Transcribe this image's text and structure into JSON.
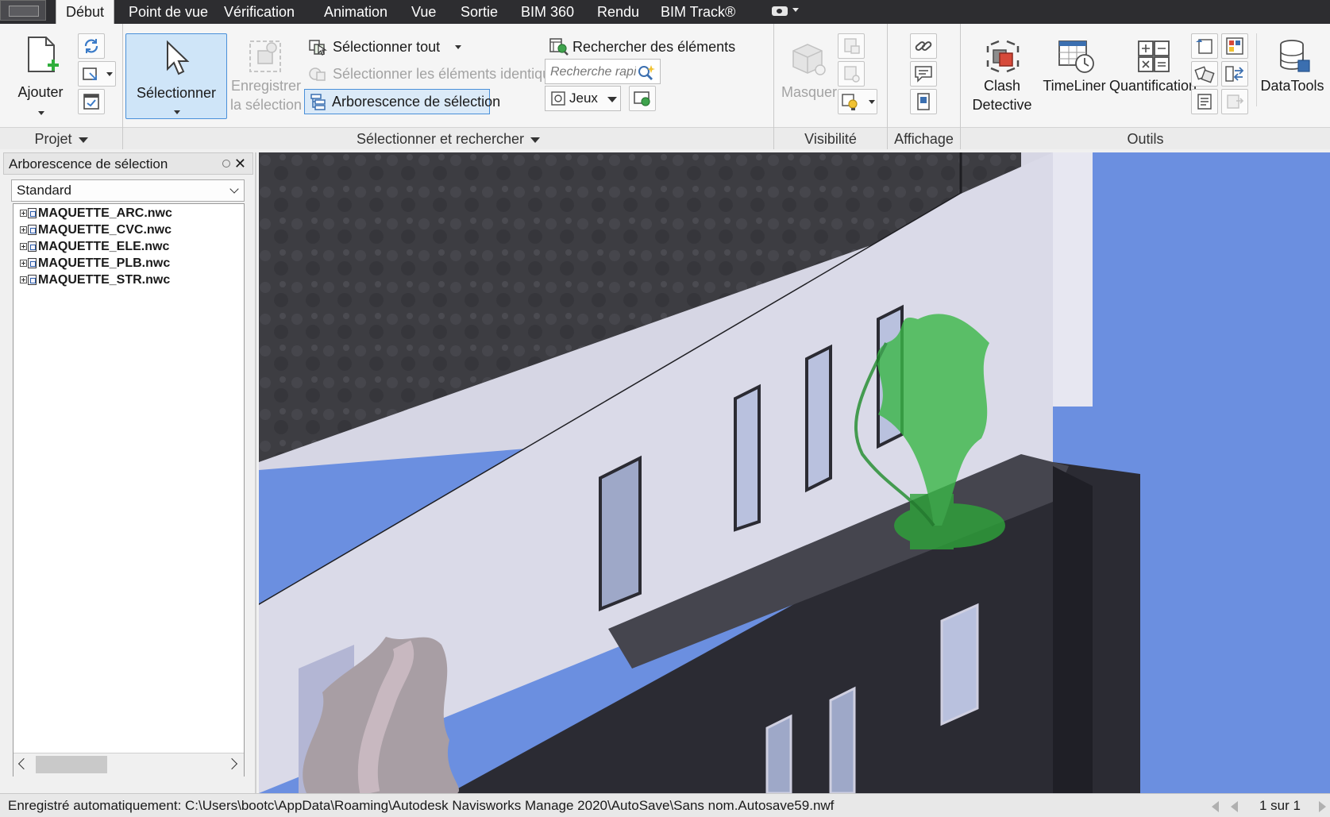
{
  "tabs": [
    {
      "label": "Début",
      "active": true
    },
    {
      "label": "Point de vue",
      "active": false
    },
    {
      "label": "Vérification",
      "active": false
    },
    {
      "label": "Animation",
      "active": false
    },
    {
      "label": "Vue",
      "active": false
    },
    {
      "label": "Sortie",
      "active": false
    },
    {
      "label": "BIM 360",
      "active": false
    },
    {
      "label": "Rendu",
      "active": false
    },
    {
      "label": "BIM Track®",
      "active": false
    }
  ],
  "ribbon": {
    "projet": {
      "title": "Projet",
      "add_label": "Ajouter"
    },
    "selection": {
      "title": "Sélectionner et rechercher",
      "select_label": "Sélectionner",
      "save_selection_line1": "Enregistrer",
      "save_selection_line2": "la sélection",
      "select_all": "Sélectionner tout",
      "select_same": "Sélectionner les éléments identiques",
      "selection_tree": "Arborescence de sélection",
      "find_items": "Rechercher des éléments",
      "quick_find_placeholder": "Recherche rapi",
      "sets_label": "Jeux"
    },
    "visibilite": {
      "title": "Visibilité",
      "hide_label": "Masquer"
    },
    "affichage": {
      "title": "Affichage"
    },
    "outils": {
      "title": "Outils",
      "clash_line1": "Clash",
      "clash_line2": "Detective",
      "timeliner": "TimeLiner",
      "quantification": "Quantification",
      "datatools": "DataTools"
    }
  },
  "pane": {
    "title": "Arborescence de sélection",
    "close_glyph": "✕",
    "dropdown_value": "Standard",
    "items": [
      "MAQUETTE_ARC.nwc",
      "MAQUETTE_CVC.nwc",
      "MAQUETTE_ELE.nwc",
      "MAQUETTE_PLB.nwc",
      "MAQUETTE_STR.nwc"
    ]
  },
  "status": {
    "text": "Enregistré automatiquement: C:\\Users\\bootc\\AppData\\Roaming\\Autodesk Navisworks Manage 2020\\AutoSave\\Sans nom.Autosave59.nwf",
    "page": "1 sur 1"
  },
  "colors": {
    "accent": "#4a90d9",
    "tab_bar": "#2d2d30",
    "sky": "#6b8fe0",
    "roof": "#3d3d42",
    "facade_light": "#d9d9e6",
    "facade_dark": "#2b2b33",
    "selected_green": "#2ea43a"
  }
}
